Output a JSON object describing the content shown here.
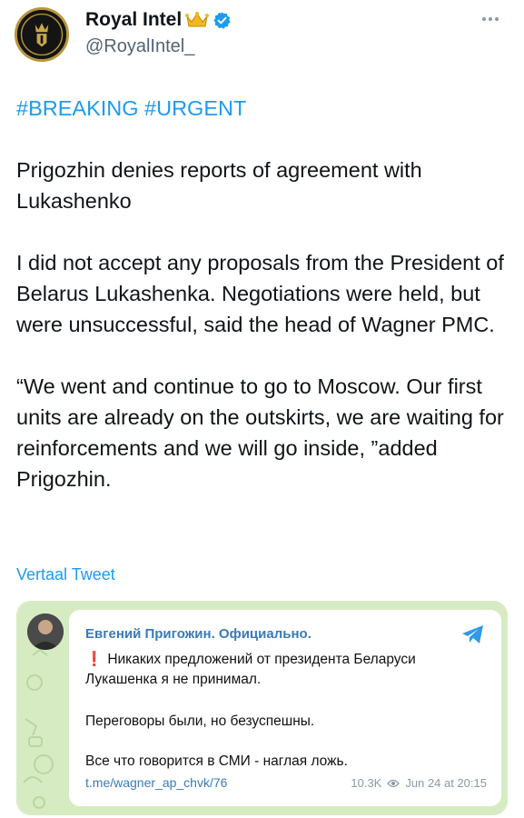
{
  "header": {
    "display_name": "Royal Intel",
    "handle": "@RoyalIntel_"
  },
  "tweet": {
    "hashtags": "#BREAKING #URGENT",
    "paragraph1": "Prigozhin denies reports of agreement with Lukashenko",
    "paragraph2": "I did not accept any proposals from the President of Belarus Lukashenka. Negotiations were held, but were unsuccessful, said the head of Wagner PMC.",
    "paragraph3": "“We went and continue to go to Moscow. Our first units are already on the outskirts, we are waiting for reinforcements and we will go inside, ”added Prigozhin.",
    "translate_label": "Vertaal Tweet"
  },
  "quote": {
    "channel": "Евгений Пригожин. Официально.",
    "exclaim": "❗",
    "line1": "Никаких предложений от президента Беларуси Лукашенка я не принимал.",
    "line2": "Переговоры были, но безуспешны.",
    "line3": "Все что говорится в СМИ - наглая ложь.",
    "link": "t.me/wagner_ap_chvk/76",
    "views": "10.3K",
    "date": "Jun 24 at 20:15"
  },
  "colors": {
    "accent": "#1d9bf0",
    "telegram_link": "#3a7ab8",
    "card_bg": "#d7ebc3"
  }
}
